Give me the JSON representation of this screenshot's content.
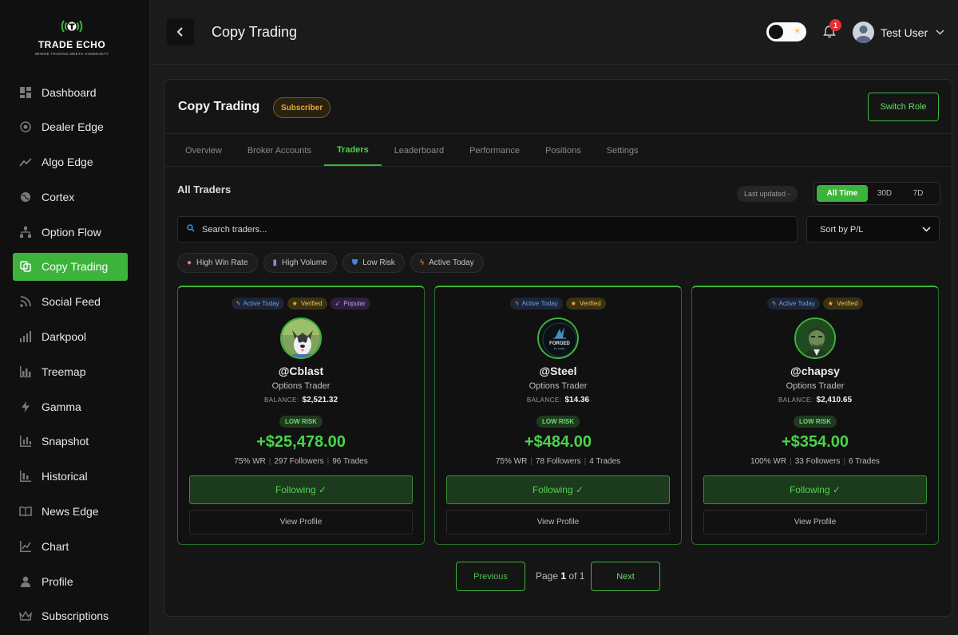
{
  "brand": {
    "name": "TRADE ECHO",
    "tagline": "WHERE TRADING MEETS COMMUNITY"
  },
  "sidebar": {
    "items": [
      {
        "label": "Dashboard",
        "icon": "dashboard-icon"
      },
      {
        "label": "Dealer Edge",
        "icon": "target-icon"
      },
      {
        "label": "Algo Edge",
        "icon": "trend-line-icon"
      },
      {
        "label": "Cortex",
        "icon": "globe-icon"
      },
      {
        "label": "Option Flow",
        "icon": "hierarchy-icon"
      },
      {
        "label": "Copy Trading",
        "icon": "copy-icon",
        "active": true
      },
      {
        "label": "Social Feed",
        "icon": "rss-icon"
      },
      {
        "label": "Darkpool",
        "icon": "signal-bars-icon"
      },
      {
        "label": "Treemap",
        "icon": "bar-chart-icon"
      },
      {
        "label": "Gamma",
        "icon": "bolt-icon"
      },
      {
        "label": "Snapshot",
        "icon": "snapshot-icon"
      },
      {
        "label": "Historical",
        "icon": "history-icon"
      },
      {
        "label": "News Edge",
        "icon": "book-icon"
      },
      {
        "label": "Chart",
        "icon": "chart-icon"
      },
      {
        "label": "Profile",
        "icon": "person-icon"
      },
      {
        "label": "Subscriptions",
        "icon": "crown-icon"
      }
    ]
  },
  "header": {
    "title": "Copy Trading",
    "notifications_count": "1",
    "user_name": "Test User"
  },
  "panel": {
    "title": "Copy Trading",
    "role_badge": "Subscriber",
    "switch_role": "Switch Role",
    "tabs": [
      "Overview",
      "Broker Accounts",
      "Traders",
      "Leaderboard",
      "Performance",
      "Positions",
      "Settings"
    ],
    "active_tab": "Traders",
    "section_title": "All Traders",
    "last_updated": "Last updated -",
    "ranges": [
      "All Time",
      "30D",
      "7D"
    ],
    "active_range": "All Time",
    "search_placeholder": "Search traders...",
    "sort_label": "Sort by P/L",
    "filters": [
      {
        "label": "High Win Rate",
        "icon": "brain-icon"
      },
      {
        "label": "High Volume",
        "icon": "bar-chart-icon"
      },
      {
        "label": "Low Risk",
        "icon": "shield-icon"
      },
      {
        "label": "Active Today",
        "icon": "bolt-icon"
      }
    ]
  },
  "traders": [
    {
      "badges": [
        "Active Today",
        "Verified",
        "Popular"
      ],
      "handle": "@Cblast",
      "role": "Options Trader",
      "balance_label": "BALANCE:",
      "balance": "$2,521.32",
      "risk": "LOW RISK",
      "pnl": "+$25,478.00",
      "win_rate": "75% WR",
      "followers": "297 Followers",
      "trades": "96 Trades",
      "follow_label": "Following ✓",
      "profile_label": "View Profile"
    },
    {
      "badges": [
        "Active Today",
        "Verified"
      ],
      "handle": "@Steel",
      "role": "Options Trader",
      "balance_label": "BALANCE:",
      "balance": "$14.36",
      "risk": "LOW RISK",
      "pnl": "+$484.00",
      "win_rate": "75% WR",
      "followers": "78 Followers",
      "trades": "4 Trades",
      "follow_label": "Following ✓",
      "profile_label": "View Profile",
      "avatar_text": "FORGED"
    },
    {
      "badges": [
        "Active Today",
        "Verified"
      ],
      "handle": "@chapsy",
      "role": "Options Trader",
      "balance_label": "BALANCE:",
      "balance": "$2,410.65",
      "risk": "LOW RISK",
      "pnl": "+$354.00",
      "win_rate": "100% WR",
      "followers": "33 Followers",
      "trades": "6 Trades",
      "follow_label": "Following ✓",
      "profile_label": "View Profile"
    }
  ],
  "pagination": {
    "prev": "Previous",
    "page_word": "Page",
    "current": "1",
    "of_word": "of",
    "total": "1",
    "next": "Next"
  },
  "colors": {
    "accent": "#3cb43c",
    "profit": "#49d449",
    "background": "#1b1b1b",
    "panel": "#151515",
    "badge_gold": "#e9a73a"
  }
}
